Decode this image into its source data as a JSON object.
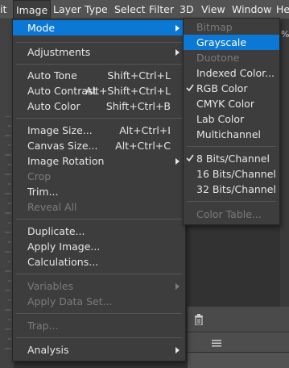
{
  "menubar": {
    "items": [
      {
        "label": "it"
      },
      {
        "label": "Image"
      },
      {
        "label": "Layer"
      },
      {
        "label": "Type"
      },
      {
        "label": "Select"
      },
      {
        "label": "Filter"
      },
      {
        "label": "3D"
      },
      {
        "label": "View"
      },
      {
        "label": "Window"
      },
      {
        "label": "He"
      }
    ]
  },
  "image_menu": {
    "items": [
      {
        "label": "Mode"
      },
      {
        "label": "Adjustments"
      },
      {
        "label": "Auto Tone",
        "shortcut": "Shift+Ctrl+L"
      },
      {
        "label": "Auto Contrast",
        "shortcut": "Alt+Shift+Ctrl+L"
      },
      {
        "label": "Auto Color",
        "shortcut": "Shift+Ctrl+B"
      },
      {
        "label": "Image Size...",
        "shortcut": "Alt+Ctrl+I"
      },
      {
        "label": "Canvas Size...",
        "shortcut": "Alt+Ctrl+C"
      },
      {
        "label": "Image Rotation"
      },
      {
        "label": "Crop"
      },
      {
        "label": "Trim..."
      },
      {
        "label": "Reveal All"
      },
      {
        "label": "Duplicate..."
      },
      {
        "label": "Apply Image..."
      },
      {
        "label": "Calculations..."
      },
      {
        "label": "Variables"
      },
      {
        "label": "Apply Data Set..."
      },
      {
        "label": "Trap..."
      },
      {
        "label": "Analysis"
      }
    ]
  },
  "mode_submenu": {
    "items": [
      {
        "label": "Bitmap"
      },
      {
        "label": "Grayscale"
      },
      {
        "label": "Duotone"
      },
      {
        "label": "Indexed Color..."
      },
      {
        "label": "RGB Color"
      },
      {
        "label": "CMYK Color"
      },
      {
        "label": "Lab Color"
      },
      {
        "label": "Multichannel"
      },
      {
        "label": "8 Bits/Channel"
      },
      {
        "label": "16 Bits/Channel"
      },
      {
        "label": "32 Bits/Channel"
      },
      {
        "label": "Color Table..."
      }
    ]
  },
  "background": {
    "right_edge_text": "%"
  },
  "colors": {
    "highlight": "#0a78d4",
    "menu_bg": "#3d3d3d",
    "menubar_bg": "#535353",
    "disabled_text": "#7b7b7b"
  },
  "icons": [
    "check-icon",
    "submenu-arrow-icon",
    "trash-icon",
    "panel-menu-icon"
  ]
}
